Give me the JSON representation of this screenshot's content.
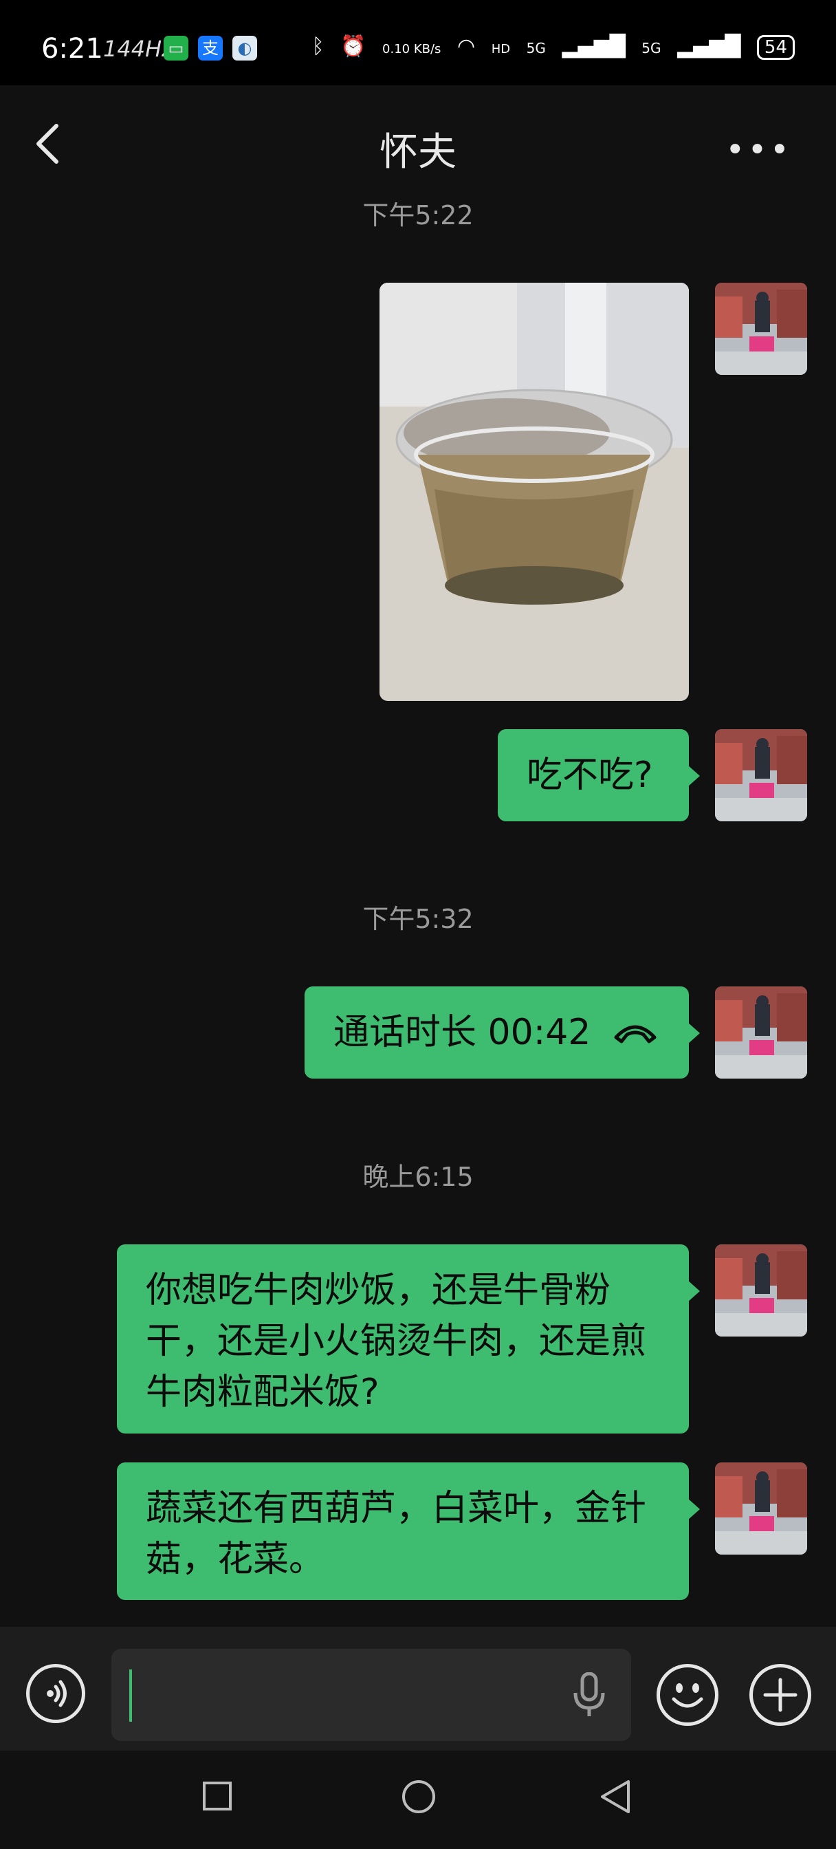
{
  "status": {
    "time": "6:21",
    "refresh": "144Hz",
    "net_speed": "0.10 KB/s",
    "network1": "5G",
    "network2": "5G",
    "battery": "54",
    "apps": [
      "messages-icon",
      "alipay-icon",
      "browser-icon"
    ]
  },
  "chat": {
    "title": "怀夫",
    "back_icon": "chevron-left-icon",
    "more_icon": "more-dots-icon"
  },
  "messages": [
    {
      "timestamp": "下午5:22"
    },
    {
      "type": "image",
      "sender": "me",
      "desc": "photo"
    },
    {
      "type": "text",
      "sender": "me",
      "text": "吃不吃?"
    },
    {
      "timestamp": "下午5:32"
    },
    {
      "type": "call",
      "sender": "me",
      "text": "通话时长 00:42"
    },
    {
      "timestamp": "晚上6:15"
    },
    {
      "type": "text",
      "sender": "me",
      "text": "你想吃牛肉炒饭，还是牛骨粉干，还是小火锅烫牛肉，还是煎牛肉粒配米饭?"
    },
    {
      "type": "text",
      "sender": "me",
      "text": "蔬菜还有西葫芦，白菜叶，金针菇，花菜。"
    }
  ],
  "input": {
    "voice_icon": "voice-toggle-icon",
    "mic_icon": "microphone-icon",
    "emoji_icon": "emoji-icon",
    "plus_icon": "plus-icon",
    "value": ""
  },
  "colors": {
    "bubble": "#3ebc6f",
    "background": "#111111",
    "inputbar": "#1d1d1d"
  }
}
